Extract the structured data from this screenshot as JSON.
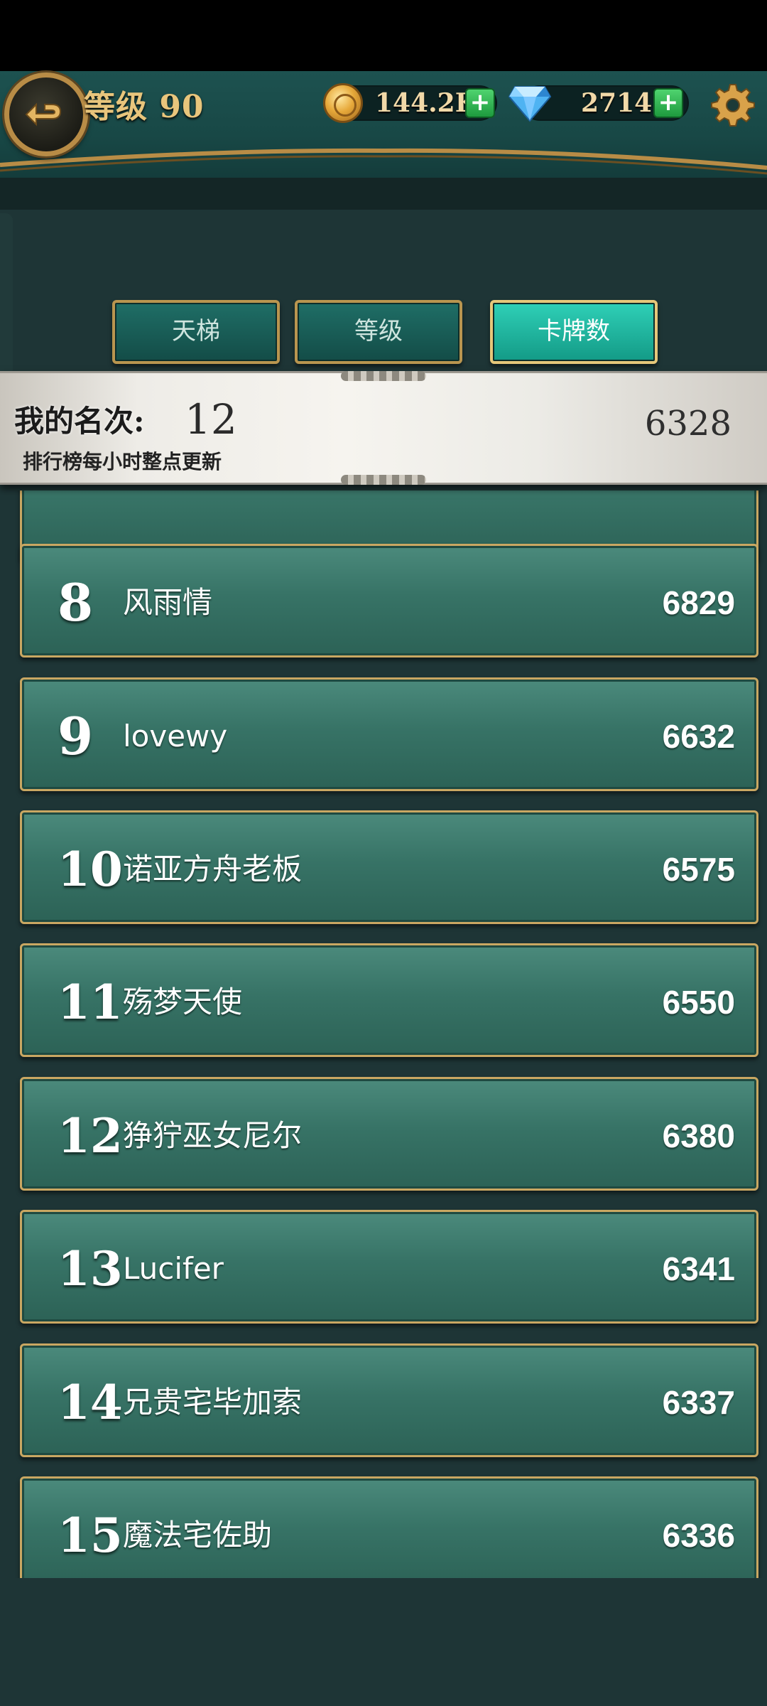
{
  "header": {
    "level_text": "等级 90",
    "coins": "144.2K",
    "gems": "2714",
    "plus_symbol": "+"
  },
  "tabs": [
    {
      "label": "天梯",
      "active": false
    },
    {
      "label": "等级",
      "active": false
    },
    {
      "label": "卡牌数",
      "active": true
    }
  ],
  "my_rank": {
    "label": "我的名次:",
    "rank": "12",
    "score": "6328",
    "note": "排行榜每小时整点更新"
  },
  "leaderboard": [
    {
      "rank": "8",
      "name": "风雨情",
      "score": "6829"
    },
    {
      "rank": "9",
      "name": "lovewy",
      "score": "6632"
    },
    {
      "rank": "10",
      "name": "诺亚方舟老板",
      "score": "6575"
    },
    {
      "rank": "11",
      "name": "殇梦天使",
      "score": "6550"
    },
    {
      "rank": "12",
      "name": "狰狞巫女尼尔",
      "score": "6380"
    },
    {
      "rank": "13",
      "name": "Lucifer",
      "score": "6341"
    },
    {
      "rank": "14",
      "name": "兄贵宅毕加索",
      "score": "6337"
    },
    {
      "rank": "15",
      "name": "魔法宅佐助",
      "score": "6336"
    }
  ],
  "colors": {
    "accent_gold": "#c9a762",
    "row_green": "#377366",
    "active_tab": "#1fb39c"
  }
}
